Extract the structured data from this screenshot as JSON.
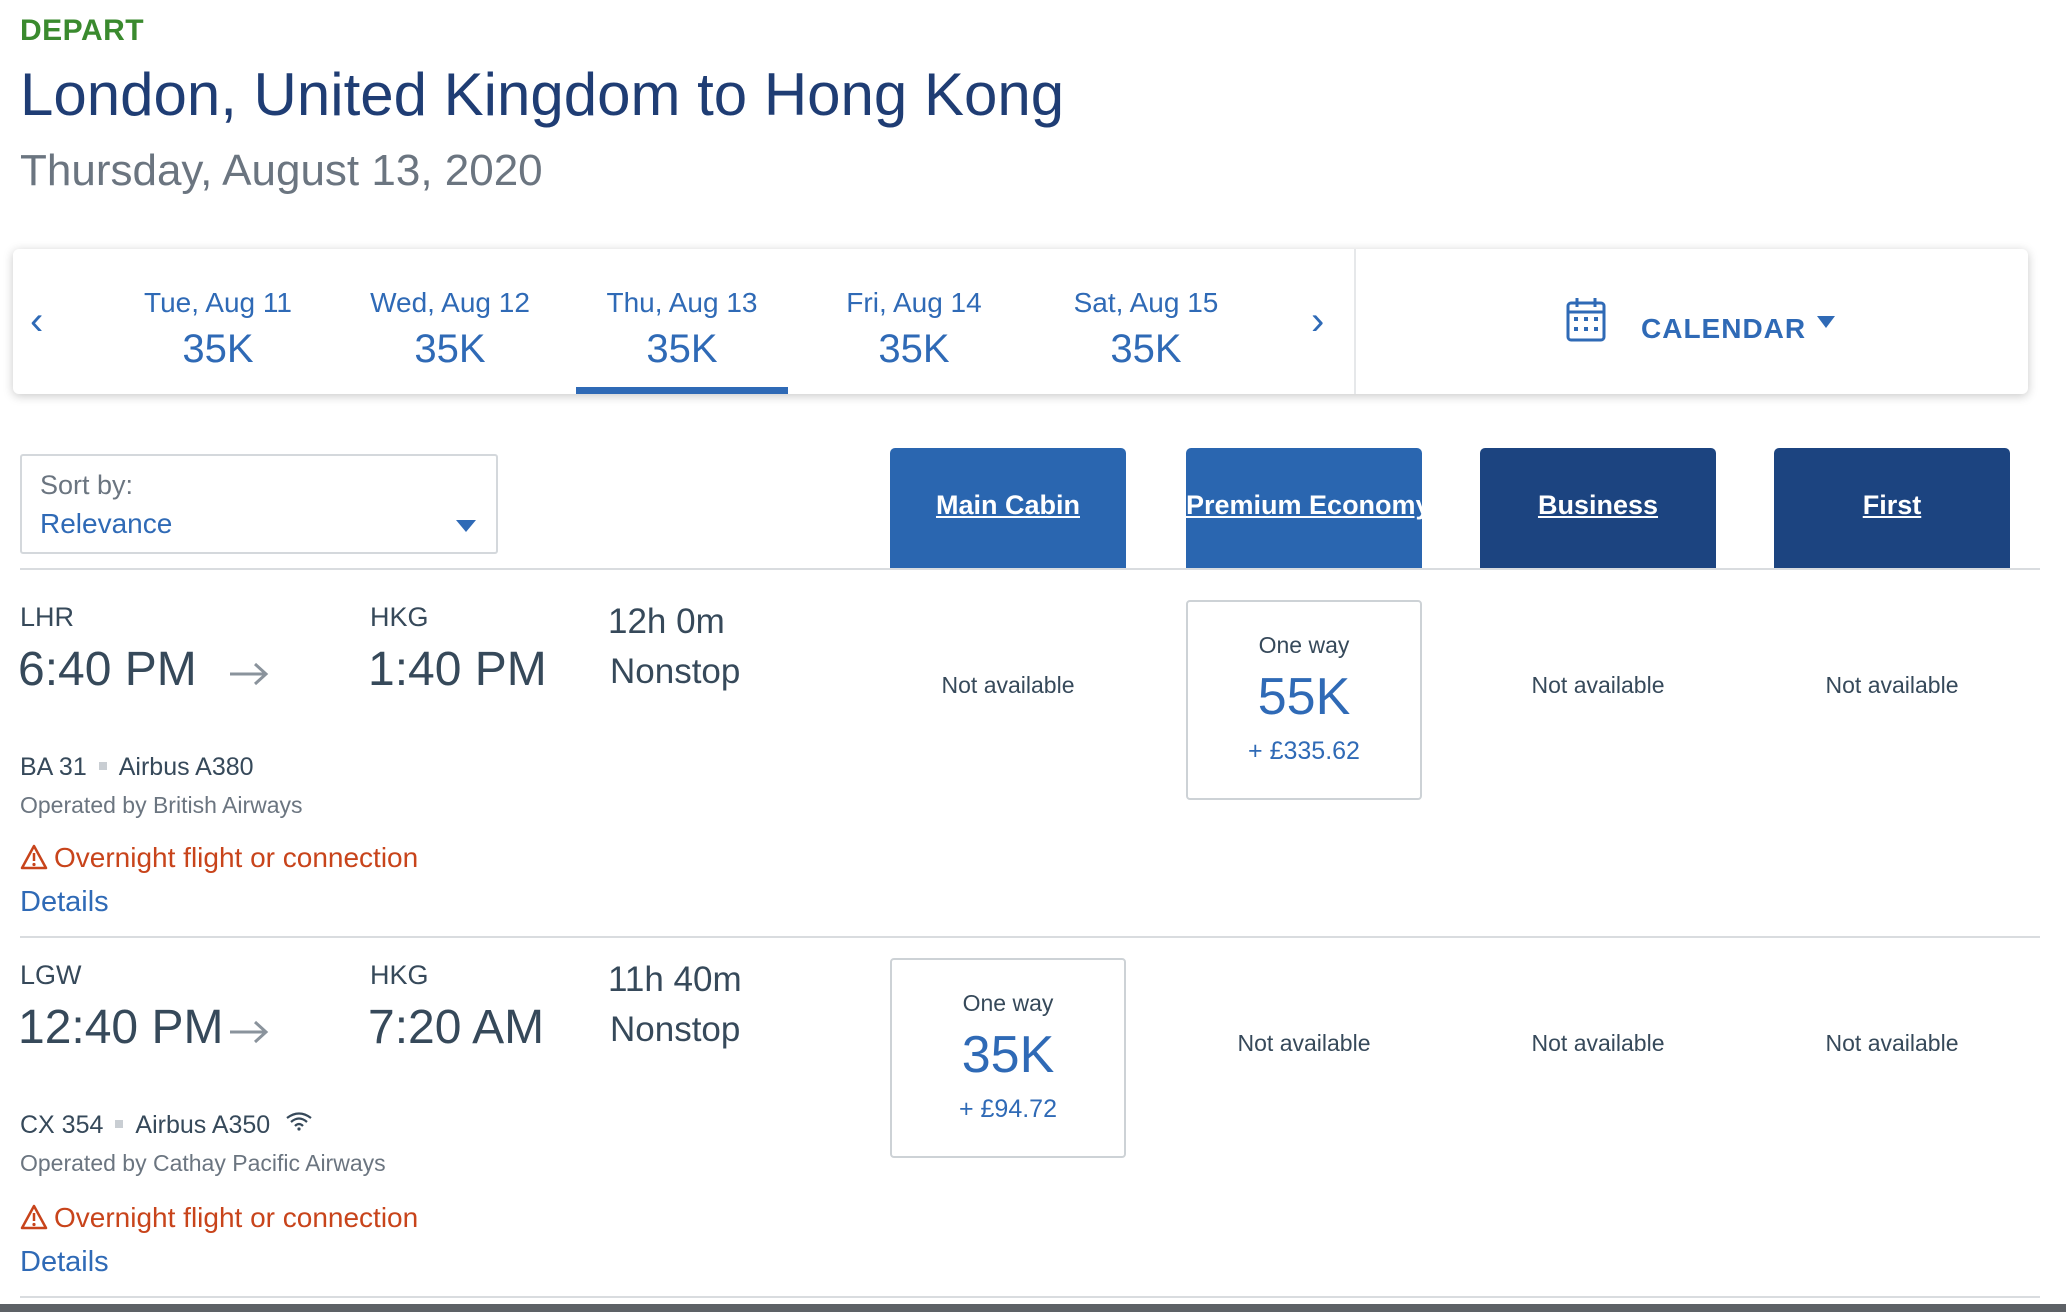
{
  "header": {
    "direction": "DEPART",
    "route": "London, United Kingdom to Hong Kong",
    "date": "Thursday, August 13, 2020"
  },
  "date_strip": {
    "prev_label": "‹",
    "next_label": "›",
    "dates": [
      {
        "label": "Tue, Aug 11",
        "value": "35K"
      },
      {
        "label": "Wed, Aug 12",
        "value": "35K"
      },
      {
        "label": "Thu, Aug 13",
        "value": "35K",
        "selected": true
      },
      {
        "label": "Fri, Aug 14",
        "value": "35K"
      },
      {
        "label": "Sat, Aug 15",
        "value": "35K"
      }
    ],
    "calendar_label": "CALENDAR"
  },
  "sort": {
    "label": "Sort by:",
    "value": "Relevance"
  },
  "cabins": [
    "Main Cabin",
    "Premium Economy",
    "Business",
    "First"
  ],
  "flights": [
    {
      "origin": "LHR",
      "depart_time": "6:40 PM",
      "destination": "HKG",
      "arrive_time": "1:40 PM",
      "duration": "12h 0m",
      "stops": "Nonstop",
      "flight_number": "BA 31",
      "aircraft": "Airbus A380",
      "operator": "Operated by British Airways",
      "warning": "Overnight flight or connection",
      "details": "Details",
      "fares": [
        {
          "available": false,
          "text": "Not available"
        },
        {
          "available": true,
          "trip": "One way",
          "points": "55K",
          "tax": "+ £335.62"
        },
        {
          "available": false,
          "text": "Not available"
        },
        {
          "available": false,
          "text": "Not available"
        }
      ]
    },
    {
      "origin": "LGW",
      "depart_time": "12:40 PM",
      "destination": "HKG",
      "arrive_time": "7:20 AM",
      "duration": "11h 40m",
      "stops": "Nonstop",
      "flight_number": "CX 354",
      "aircraft": "Airbus A350",
      "wifi": true,
      "operator": "Operated by Cathay Pacific Airways",
      "warning": "Overnight flight or connection",
      "details": "Details",
      "fares": [
        {
          "available": true,
          "trip": "One way",
          "points": "35K",
          "tax": "+ £94.72"
        },
        {
          "available": false,
          "text": "Not available"
        },
        {
          "available": false,
          "text": "Not available"
        },
        {
          "available": false,
          "text": "Not available"
        }
      ]
    }
  ],
  "colors": {
    "primary_blue": "#2f6ab6",
    "navy": "#1f3d74",
    "cabin_light": "#2a66b0",
    "cabin_dark": "#1c4480",
    "depart_green": "#3a8a2e",
    "warning_orange": "#c8441b"
  },
  "icons": [
    "chevron-left-icon",
    "chevron-right-icon",
    "calendar-icon",
    "caret-down-icon",
    "arrow-right-icon",
    "warning-triangle-icon",
    "wifi-icon"
  ]
}
